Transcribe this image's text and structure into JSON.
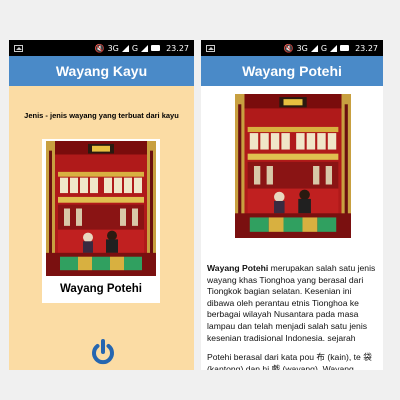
{
  "screens": [
    {
      "status": {
        "network": "3G",
        "carrier": "G",
        "time": "23.27"
      },
      "title": "Wayang Kayu",
      "subtitle": "Jenis - jenis wayang yang terbuat dari kayu",
      "card": {
        "caption": "Wayang Potehi",
        "image": "potehi-stage-photo"
      },
      "power_icon": "power-icon"
    },
    {
      "status": {
        "network": "3G",
        "carrier": "G",
        "time": "23.27"
      },
      "title": "Wayang Potehi",
      "image": "potehi-stage-photo",
      "article": {
        "p1_bold": "Wayang Potehi",
        "p1_rest": " merupakan salah satu jenis wayang khas Tionghoa yang berasal dari Tiongkok bagian selatan. Kesenian ini dibawa oleh perantau etnis Tionghoa ke berbagai wilayah Nusantara pada masa lampau dan telah menjadi salah satu jenis kesenian tradisional Indonesia. sejarah",
        "p2": "Potehi berasal dari kata pou 布 (kain), te 袋 (kantong) dan hi 戲 (wayang). Wayang"
      }
    }
  ],
  "colors": {
    "appbar": "#4a8ac8",
    "left_bg": "#fbdca4",
    "power": "#2566b0"
  }
}
